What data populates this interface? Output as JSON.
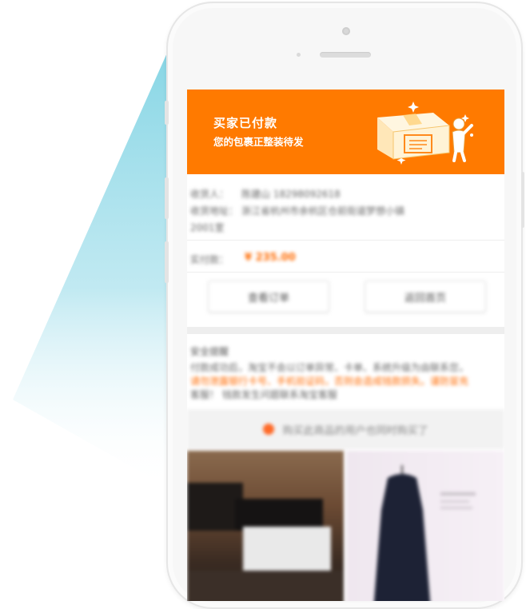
{
  "banner": {
    "title": "买家已付款",
    "subtitle": "您的包裹正整装待发"
  },
  "order": {
    "receiver_label": "收货人：",
    "receiver_value": "陈建山 18298092618",
    "address_label": "收货地址：",
    "address_value": "浙江省杭州市余杭区仓前街道梦想小镇",
    "address_value_2": "2001室",
    "paid_label": "实付款：",
    "paid_value": "¥ 235.00"
  },
  "buttons": {
    "view_order": "查看订单",
    "back_home": "返回首页"
  },
  "notice": {
    "heading": "安全提醒",
    "line1": "付款成功后，淘宝不会以订单异常、卡单、系统升级为由联系您，",
    "line2": "请勿泄露银行卡号、手机验证码，否则会造成钱款损失。谨防冒充",
    "line3": "客服！ 钱款发生问题联系淘宝客服"
  },
  "recommend": {
    "text": "购买此商品的用户也同时购买了"
  },
  "colors": {
    "accent": "#ff7a00",
    "price": "#ff6a00"
  }
}
